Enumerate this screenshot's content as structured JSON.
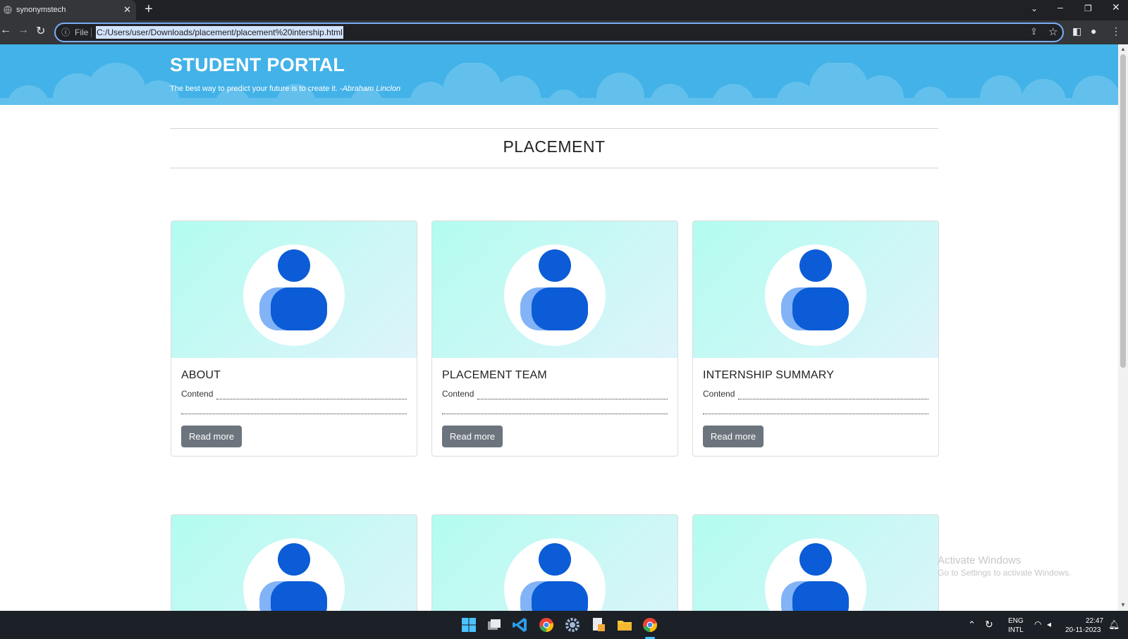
{
  "browser": {
    "tab_title": "synonymstech",
    "url_scheme": "File",
    "url": "C:/Users/user/Downloads/placement/placement%20intership.html"
  },
  "page": {
    "portal_title": "STUDENT PORTAL",
    "quote_text": "The best way to predict your future is to create it. -",
    "quote_author": "Abraham Linclon",
    "section_title": "PLACEMENT",
    "cards": [
      {
        "title": "ABOUT",
        "text": "Contend",
        "button": "Read more"
      },
      {
        "title": "PLACEMENT TEAM",
        "text": "Contend",
        "button": "Read more"
      },
      {
        "title": "INTERNSHIP SUMMARY",
        "text": "Contend",
        "button": "Read more"
      }
    ]
  },
  "watermark": {
    "line1": "Activate Windows",
    "line2": "Go to Settings to activate Windows."
  },
  "taskbar": {
    "lang_top": "ENG",
    "lang_bottom": "INTL",
    "time": "22:47",
    "date": "20-11-2023"
  },
  "colors": {
    "hero": "#42b2e8",
    "button": "#6c757d",
    "avatar_dark": "#0b5cd6",
    "avatar_light": "#82b3f7"
  }
}
